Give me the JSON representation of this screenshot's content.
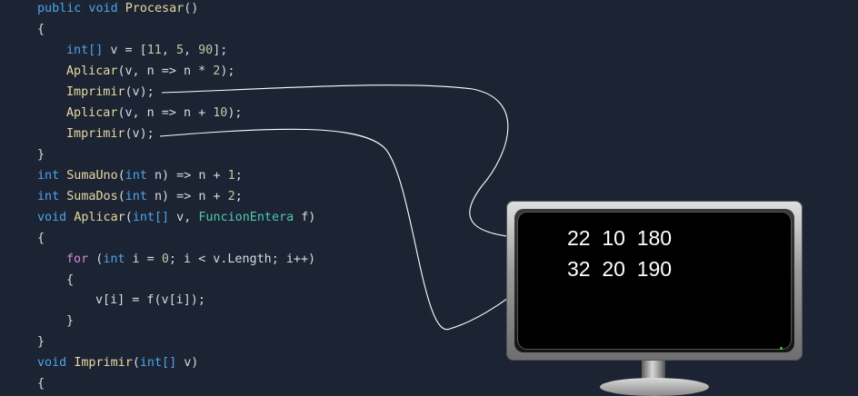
{
  "code": {
    "l1_kw": "public void",
    "l1_name": "Procesar",
    "l1_rest": "()",
    "l2": "{",
    "l3_type": "int[]",
    "l3_mid": " v = [",
    "l3_n1": "11",
    "l3_c1": ", ",
    "l3_n2": "5",
    "l3_c2": ", ",
    "l3_n3": "90",
    "l3_end": "];",
    "l4_fn": "Aplicar",
    "l4_mid": "(v, n => n * ",
    "l4_n": "2",
    "l4_end": ");",
    "l5_fn": "Imprimir",
    "l5_rest": "(v);",
    "l6_fn": "Aplicar",
    "l6_mid": "(v, n => n + ",
    "l6_n": "10",
    "l6_end": ");",
    "l7_fn": "Imprimir",
    "l7_rest": "(v);",
    "l8": "}",
    "l9_kw": "int",
    "l9_fn": "SumaUno",
    "l9_p1": "(",
    "l9_kw2": "int",
    "l9_p2": " n) => n + ",
    "l9_n": "1",
    "l9_end": ";",
    "l10_kw": "int",
    "l10_fn": "SumaDos",
    "l10_p1": "(",
    "l10_kw2": "int",
    "l10_p2": " n) => n + ",
    "l10_n": "2",
    "l10_end": ";",
    "l11_kw": "void",
    "l11_fn": "Aplicar",
    "l11_p1": "(",
    "l11_kw2": "int[]",
    "l11_p2": " v, ",
    "l11_ty": "FuncionEntera",
    "l11_end": " f)",
    "l12": "{",
    "l13_ctl": "for",
    "l13_p1": " (",
    "l13_kw": "int",
    "l13_p2": " i = ",
    "l13_n": "0",
    "l13_end": "; i < v.Length; i++)",
    "l14": "{",
    "l15": "v[i] = f(v[i]);",
    "l16": "}",
    "l17": "}",
    "l18_kw": "void",
    "l18_fn": "Imprimir",
    "l18_p1": "(",
    "l18_kw2": "int[]",
    "l18_end": " v)",
    "l19": "{"
  },
  "output": {
    "line1": "22  10  180",
    "line2": "32  20  190"
  },
  "colors": {
    "background": "#1c2433",
    "keyword": "#4ea3e8",
    "function": "#e8d9a0",
    "type": "#4ec9b0",
    "number": "#b5cea8"
  }
}
